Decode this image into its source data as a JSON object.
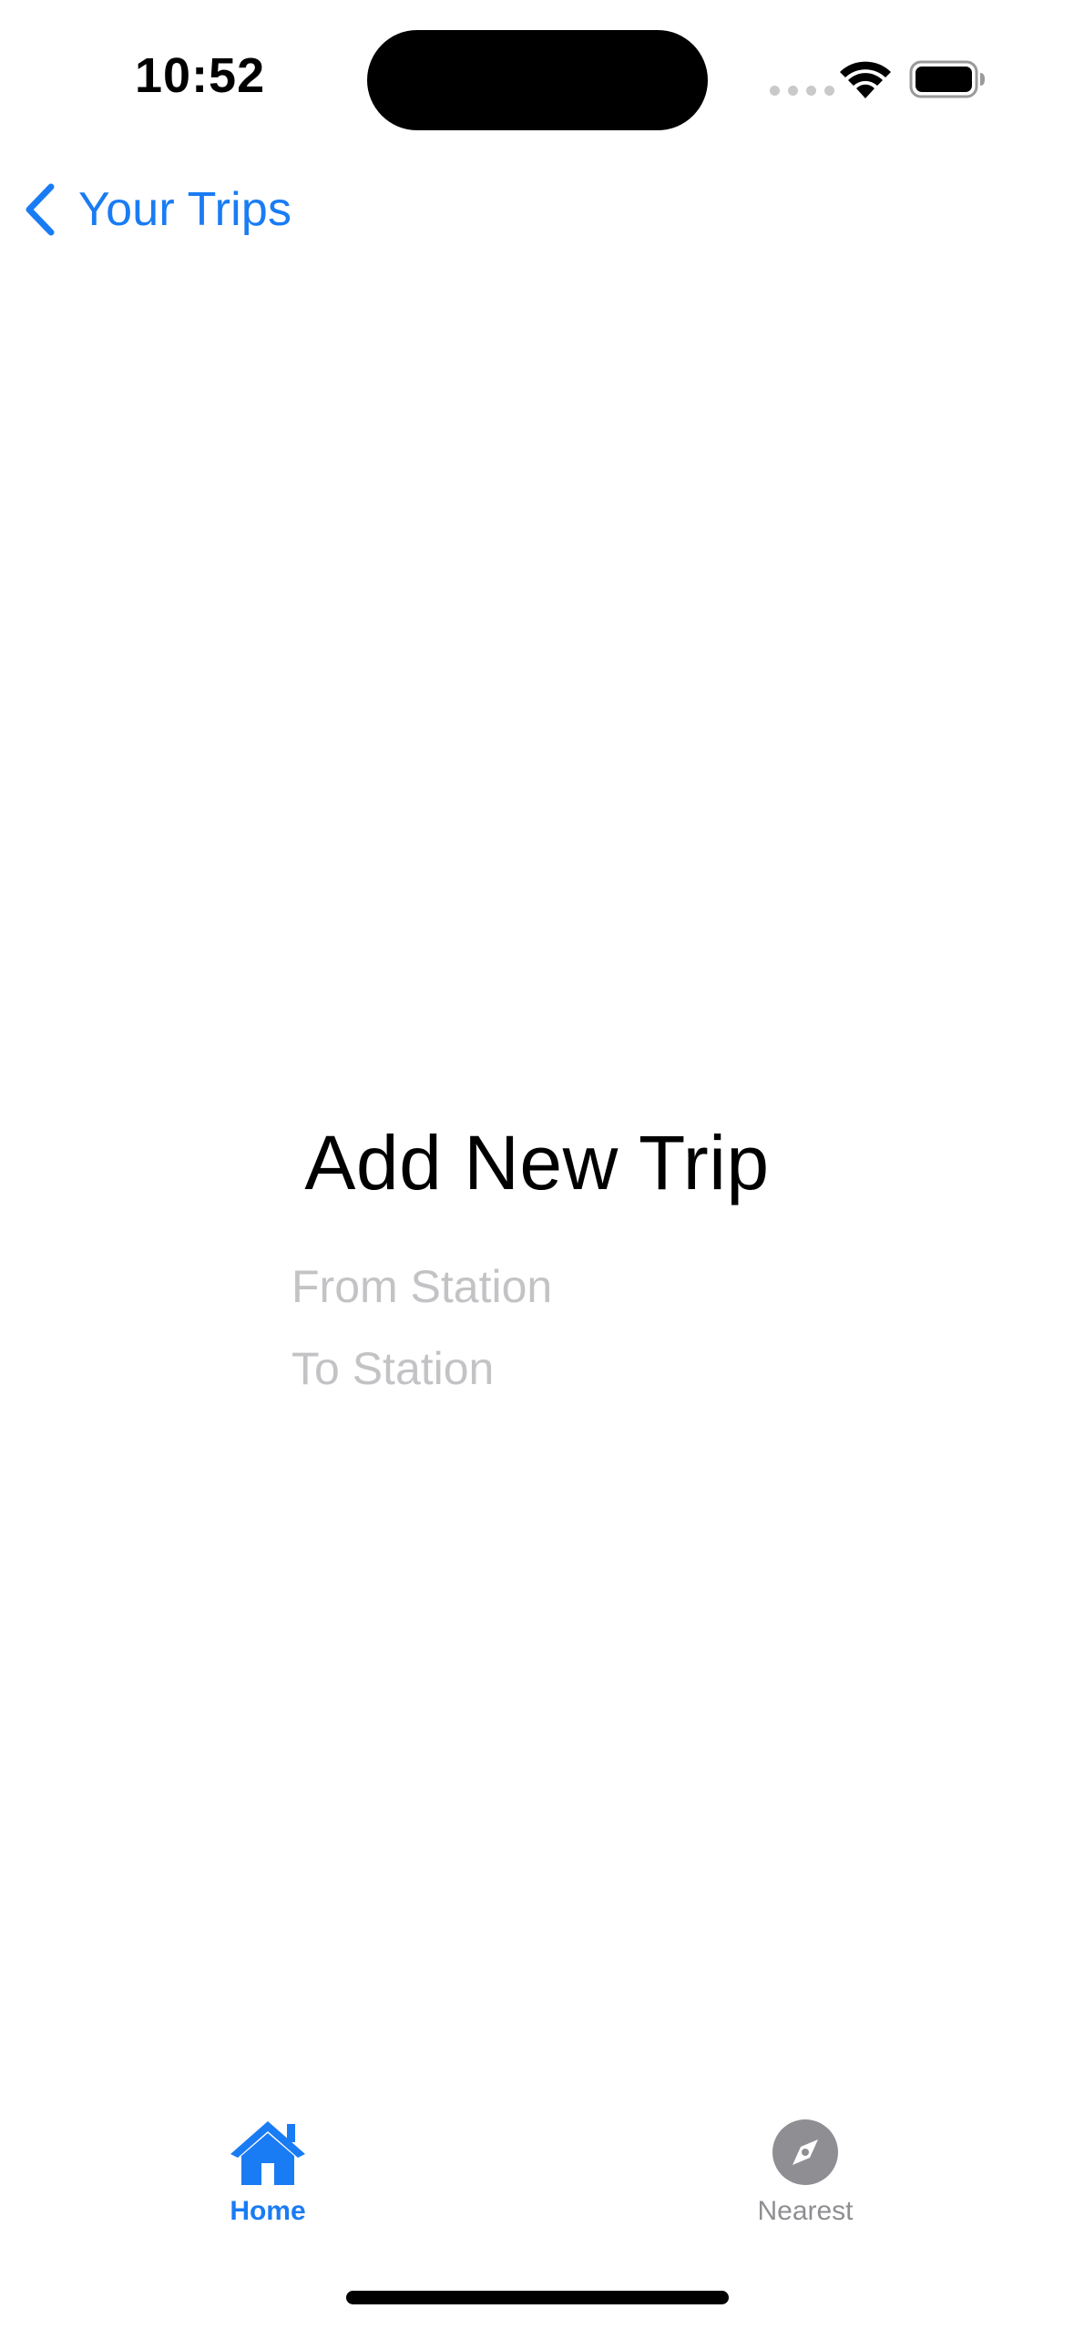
{
  "status_bar": {
    "time": "10:52"
  },
  "navigation": {
    "back_label": "Your Trips",
    "back_icon": "chevron-left-icon"
  },
  "form": {
    "title": "Add New Trip",
    "from_placeholder": "From Station",
    "from_value": "",
    "to_placeholder": "To Station",
    "to_value": ""
  },
  "tab_bar": {
    "items": [
      {
        "label": "Home",
        "icon": "house-icon",
        "selected": true
      },
      {
        "label": "Nearest",
        "icon": "compass-icon",
        "selected": false
      }
    ]
  },
  "colors": {
    "accent": "#1a7cf4",
    "placeholder": "#c3c3c6",
    "inactive_tab": "#8e8e93"
  }
}
